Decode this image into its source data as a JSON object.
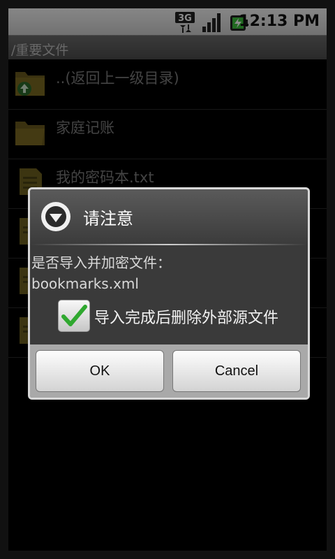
{
  "status_bar": {
    "time": "12:13 PM",
    "network_label": "3G",
    "icons": [
      "3g-data-icon",
      "signal-icon",
      "battery-charging-icon"
    ]
  },
  "path_bar": {
    "path": "/重要文件"
  },
  "file_list": [
    {
      "name": "..(返回上一级目录)",
      "icon": "folder-up-icon"
    },
    {
      "name": "家庭记账",
      "icon": "folder-icon"
    },
    {
      "name": "我的密码本.txt",
      "icon": "text-file-icon"
    },
    {
      "name": "",
      "icon": "text-file-icon"
    },
    {
      "name": "",
      "icon": "text-file-icon"
    },
    {
      "name": "",
      "icon": "text-file-icon"
    }
  ],
  "dialog": {
    "title": "请注意",
    "message_line1": "是否导入并加密文件：",
    "message_line2": "bookmarks.xml",
    "checkbox_label": "导入完成后删除外部源文件",
    "checkbox_checked": true,
    "ok_label": "OK",
    "cancel_label": "Cancel"
  },
  "colors": {
    "status_bar": "#dcdcdc",
    "dialog_background": "#3a3a3a",
    "check_green": "#2fa82f"
  }
}
